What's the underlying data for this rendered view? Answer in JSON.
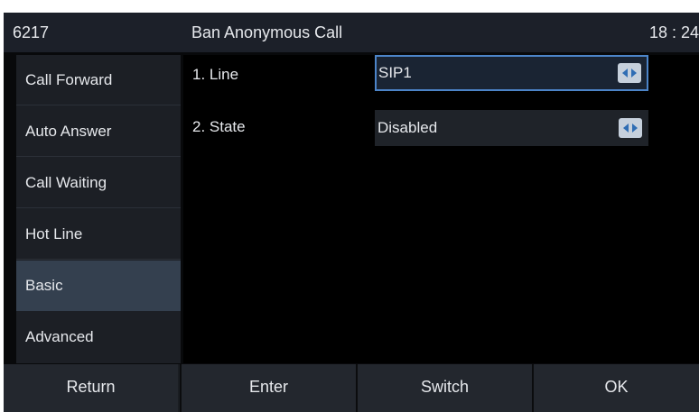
{
  "header": {
    "extension": "6217",
    "title": "Ban Anonymous Call",
    "time": "18 : 24"
  },
  "sidebar": {
    "items": [
      {
        "label": "Call Forward"
      },
      {
        "label": "Auto Answer"
      },
      {
        "label": "Call Waiting"
      },
      {
        "label": "Hot Line"
      },
      {
        "label": "Basic",
        "active": true
      },
      {
        "label": "Advanced"
      }
    ]
  },
  "settings": [
    {
      "label": "1. Line",
      "value": "SIP1",
      "focused": true,
      "icon": "left-right-arrows-icon"
    },
    {
      "label": "2. State",
      "value": "Disabled",
      "focused": false,
      "icon": "left-right-arrows-icon"
    }
  ],
  "softkeys": [
    {
      "label": "Return"
    },
    {
      "label": "Enter"
    },
    {
      "label": "Switch"
    },
    {
      "label": "OK"
    }
  ],
  "colors": {
    "accent": "#4c84c8",
    "active_item": "#34404f",
    "arrow_button": "#c6d0dc",
    "arrow_glyph": "#2f6db4"
  }
}
